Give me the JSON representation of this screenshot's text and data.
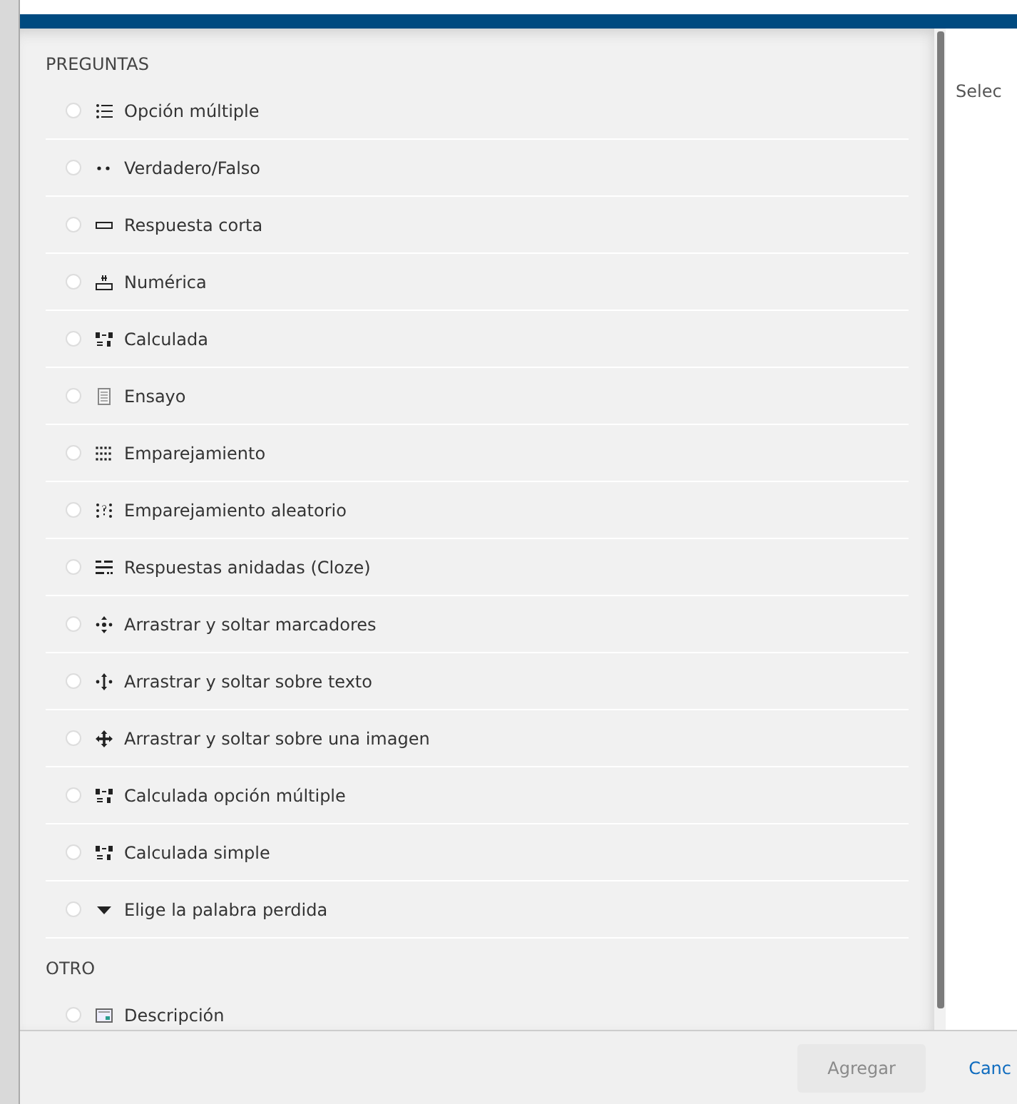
{
  "sections": [
    {
      "title": "PREGUNTAS",
      "items": [
        {
          "label": "Opción múltiple",
          "kind": "multichoice",
          "selected": false
        },
        {
          "label": "Verdadero/Falso",
          "kind": "truefalse",
          "selected": false
        },
        {
          "label": "Respuesta corta",
          "kind": "shortanswer",
          "selected": false
        },
        {
          "label": "Numérica",
          "kind": "numerical",
          "selected": false
        },
        {
          "label": "Calculada",
          "kind": "calculated",
          "selected": false
        },
        {
          "label": "Ensayo",
          "kind": "essay",
          "selected": false
        },
        {
          "label": "Emparejamiento",
          "kind": "match",
          "selected": false
        },
        {
          "label": "Emparejamiento aleatorio",
          "kind": "randommatch",
          "selected": false
        },
        {
          "label": "Respuestas anidadas (Cloze)",
          "kind": "cloze",
          "selected": false
        },
        {
          "label": "Arrastrar y soltar marcadores",
          "kind": "ddmarker",
          "selected": false
        },
        {
          "label": "Arrastrar y soltar sobre texto",
          "kind": "ddtext",
          "selected": false
        },
        {
          "label": "Arrastrar y soltar sobre una imagen",
          "kind": "ddimage",
          "selected": false
        },
        {
          "label": "Calculada opción múltiple",
          "kind": "calculated",
          "selected": false
        },
        {
          "label": "Calculada simple",
          "kind": "calculated",
          "selected": false
        },
        {
          "label": "Elige la palabra perdida",
          "kind": "gapselect",
          "selected": false
        }
      ]
    },
    {
      "title": "OTRO",
      "items": [
        {
          "label": "Descripción",
          "kind": "description",
          "selected": false
        }
      ]
    }
  ],
  "details": {
    "text": "Selec"
  },
  "footer": {
    "buttons": [
      {
        "label": "Agregar",
        "kind": "primary",
        "disabled": true
      },
      {
        "label": "Canc",
        "kind": "link",
        "disabled": false
      }
    ]
  }
}
